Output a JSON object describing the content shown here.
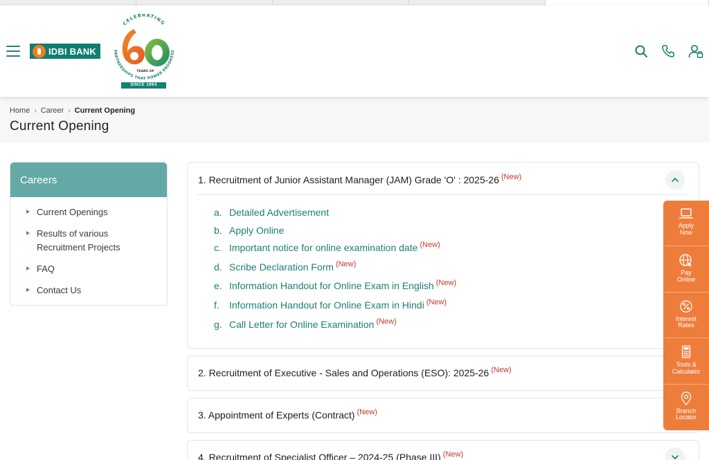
{
  "header": {
    "logo_text": "IDBI BANK",
    "anniversary_badge": {
      "top_text": "CELEBRATING",
      "number": "60",
      "years_text": "YEARS OF",
      "ring_text": "PARTNERSHIPS THAT POWER PROGRESS",
      "since_text": "SINCE 1964"
    },
    "icons": [
      "search-icon",
      "phone-icon",
      "user-account-icon"
    ]
  },
  "breadcrumb": {
    "items": [
      "Home",
      "Career"
    ],
    "current": "Current Opening"
  },
  "page_title": "Current Opening",
  "sidebar": {
    "heading": "Careers",
    "items": [
      "Current Openings",
      "Results of various\nRecruitment Projects",
      "FAQ",
      "Contact Us"
    ]
  },
  "accordion": [
    {
      "title": "1. Recruitment of Junior Assistant Manager (JAM) Grade 'O' : 2025-26",
      "badge": "(New)",
      "expanded": true,
      "links": [
        {
          "letter": "a.",
          "text": "Detailed Advertisement",
          "badge": ""
        },
        {
          "letter": "b.",
          "text": "Apply Online",
          "badge": ""
        },
        {
          "letter": "c.",
          "text": "Important notice for online examination date",
          "badge": "(New)"
        },
        {
          "letter": "d.",
          "text": "Scribe Declaration Form",
          "badge": "(New)"
        },
        {
          "letter": "e.",
          "text": "Information Handout for Online Exam in English",
          "badge": "(New)"
        },
        {
          "letter": "f.",
          "text": "Information Handout for Online Exam in Hindi",
          "badge": "(New)"
        },
        {
          "letter": "g.",
          "text": "Call Letter for Online Examination",
          "badge": "(New)"
        }
      ]
    },
    {
      "title": "2. Recruitment of Executive - Sales and Operations (ESO): 2025-26",
      "badge": "(New)",
      "expanded": false
    },
    {
      "title": "3. Appointment of Experts (Contract)",
      "badge": "(New)",
      "expanded": false
    },
    {
      "title": "4. Recruitment of Specialist Officer – 2024-25 (Phase III)",
      "badge": "(New)",
      "expanded": false
    }
  ],
  "floating_bar": {
    "items": [
      {
        "label": "Apply\nNow",
        "icon": "laptop-icon"
      },
      {
        "label": "Pay\nOnline",
        "icon": "globe-icon"
      },
      {
        "label": "Interest\nRates",
        "icon": "percent-icon"
      },
      {
        "label": "Tools &\nCalculator",
        "icon": "calculator-icon"
      },
      {
        "label": "Branch\nLocator",
        "icon": "location-pin-icon"
      }
    ]
  },
  "colors": {
    "brand_green": "#0e7f70",
    "link_green": "#1b7f72",
    "sidebar_head": "#64a9a5",
    "float_orange": "#ee7d3c",
    "new_badge_red": "#c0392b"
  }
}
